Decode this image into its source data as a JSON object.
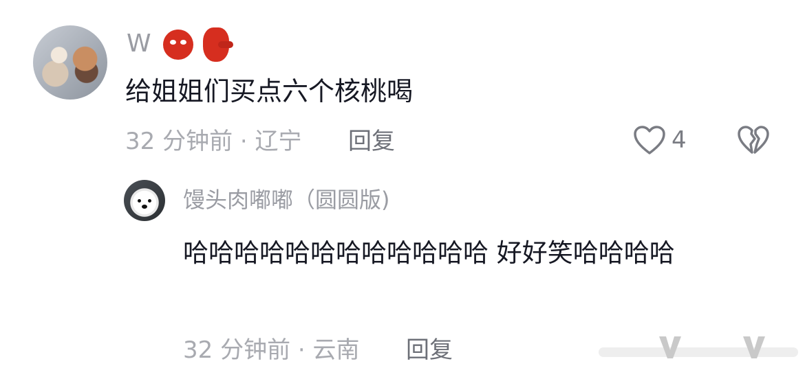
{
  "comment": {
    "username": "W",
    "text": "给姐姐们买点六个核桃喝",
    "time": "32 分钟前",
    "separator": "·",
    "location": "辽宁",
    "reply_label": "回复",
    "like_count": "4"
  },
  "reply": {
    "username": "馒头肉嘟嘟（圆圆版)",
    "text": "哈哈哈哈哈哈哈哈哈哈哈哈 好好笑哈哈哈哈",
    "time": "32 分钟前",
    "separator": "·",
    "location": "云南",
    "reply_label": "回复"
  },
  "icons": {
    "heart": "heart-outline-icon",
    "dislike": "broken-heart-icon",
    "emoji_1": "ogre-emoji",
    "emoji_2": "goblin-emoji"
  },
  "colors": {
    "text": "#161823",
    "meta": "#a8aab0",
    "username": "#9a9ca3",
    "reply_action": "#6d7078"
  }
}
